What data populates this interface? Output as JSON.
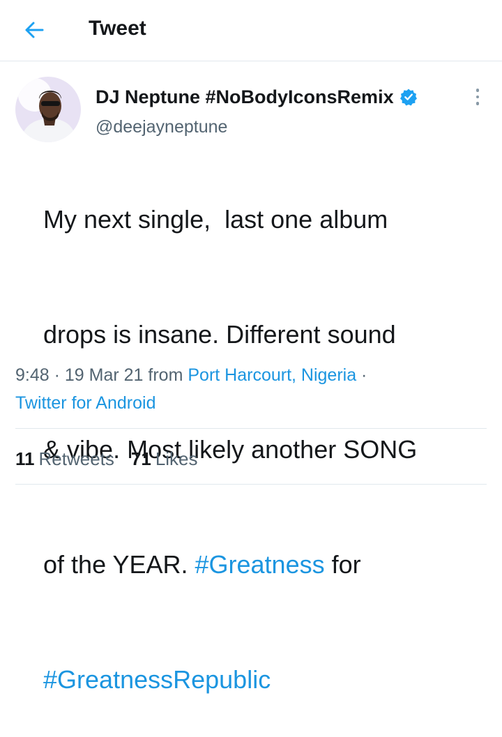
{
  "header": {
    "title": "Tweet",
    "back_icon": "arrow-left-icon",
    "accent_color": "#1da1f2"
  },
  "author": {
    "display_name": "DJ Neptune #NoBodyIconsRemix",
    "handle": "@deejayneptune",
    "verified": true,
    "verified_icon": "verified-badge-icon",
    "more_icon": "more-vertical-icon"
  },
  "tweet": {
    "lines": [
      [
        {
          "text": "My next single,  last one album"
        }
      ],
      [
        {
          "text": "drops is insane. Different sound"
        }
      ],
      [
        {
          "text": "& vibe. Most likely another SONG"
        }
      ],
      [
        {
          "text": "of the YEAR. "
        },
        {
          "text": "#Greatness",
          "hashtag": true
        },
        {
          "text": " for"
        }
      ],
      [
        {
          "text": "#GreatnessRepublic",
          "hashtag": true
        }
      ]
    ]
  },
  "meta": {
    "time": "9:48",
    "sep1": " · ",
    "date": "19 Mar 21",
    "from_label": " from ",
    "location": "Port Harcourt, Nigeria",
    "sep2": " ·",
    "source": "Twitter for Android"
  },
  "stats": {
    "retweets_count": "11",
    "retweets_label": "Retweets",
    "likes_count": "71",
    "likes_label": "Likes"
  },
  "colors": {
    "link": "#1b95e0",
    "secondary_text": "#536471",
    "primary_text": "#14171a",
    "divider": "#e1e8ed"
  }
}
